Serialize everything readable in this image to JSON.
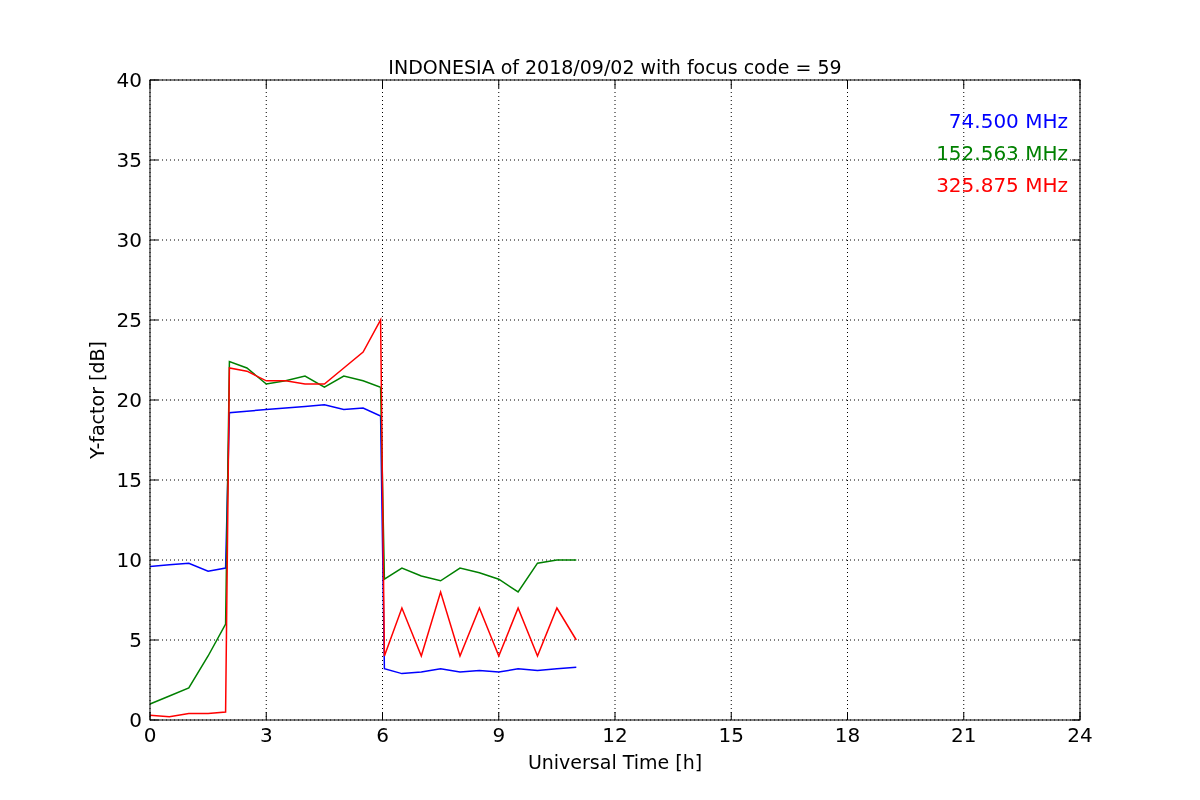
{
  "figure": {
    "chart_data": {
      "type": "line",
      "title": "INDONESIA of 2018/09/02 with focus code = 59",
      "xlabel": "Universal Time [h]",
      "ylabel": "Y-factor [dB]",
      "x": [
        0,
        0.5,
        1,
        1.5,
        1.95,
        2.05,
        2.5,
        3,
        3.5,
        4,
        4.5,
        5,
        5.5,
        5.95,
        6.05,
        6.5,
        7,
        7.5,
        8,
        8.5,
        9,
        9.5,
        10,
        10.5,
        11
      ],
      "series": [
        {
          "name": "74.500 MHz",
          "color": "#0000ff",
          "values": [
            9.6,
            9.7,
            9.8,
            9.3,
            9.5,
            19.2,
            19.3,
            19.4,
            19.5,
            19.6,
            19.7,
            19.4,
            19.5,
            19.0,
            3.2,
            2.9,
            3.0,
            3.2,
            3.0,
            3.1,
            3.0,
            3.2,
            3.1,
            3.2,
            3.3
          ]
        },
        {
          "name": "152.563 MHz",
          "color": "#008000",
          "values": [
            1,
            1.5,
            2,
            4,
            6,
            22.4,
            22,
            21,
            21.2,
            21.5,
            20.8,
            21.5,
            21.2,
            20.8,
            8.8,
            9.5,
            9,
            8.7,
            9.5,
            9.2,
            8.8,
            8,
            9.8,
            10,
            10
          ]
        },
        {
          "name": "325.875 MHz",
          "color": "#ff0000",
          "values": [
            0.3,
            0.2,
            0.4,
            0.4,
            0.5,
            22,
            21.8,
            21.2,
            21.2,
            21,
            21,
            22,
            23,
            25,
            4,
            7,
            4,
            8,
            4,
            7,
            4,
            7,
            4,
            7,
            5
          ]
        }
      ],
      "xlim": [
        0,
        24
      ],
      "ylim": [
        0,
        40
      ],
      "xticks": [
        0,
        3,
        6,
        9,
        12,
        15,
        18,
        21,
        24
      ],
      "yticks": [
        0,
        5,
        10,
        15,
        20,
        25,
        30,
        35,
        40
      ],
      "grid": true
    }
  }
}
